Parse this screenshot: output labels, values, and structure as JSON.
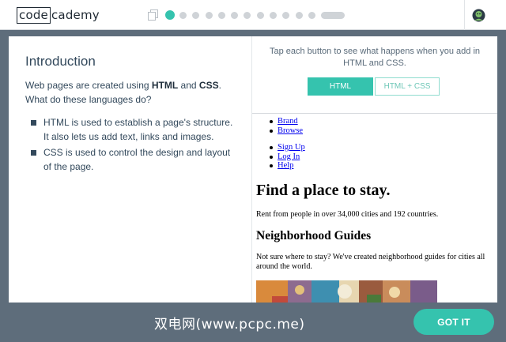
{
  "header": {
    "logo_box": "code",
    "logo_rest": "cademy",
    "progress": {
      "total_dots": 13,
      "current": 1
    },
    "icons": {
      "left": "document-icon",
      "right": "avatar-icon"
    }
  },
  "lesson": {
    "title": "Introduction",
    "intro_prefix": "Web pages are created using ",
    "intro_html": "HTML",
    "intro_and": " and ",
    "intro_css": "CSS",
    "intro_suffix": ". What do these languages do?",
    "bullets": [
      "HTML is used to establish a page's structure. It also lets us add text, links and images.",
      "CSS is used to control the design and layout of the page."
    ]
  },
  "demo": {
    "instruction": "Tap each button to see what happens when you add in HTML and CSS.",
    "btn_html": "HTML",
    "btn_html_css": "HTML + CSS"
  },
  "preview": {
    "nav1": [
      "Brand",
      "Browse"
    ],
    "nav2": [
      "Sign Up",
      "Log In",
      "Help"
    ],
    "h1": "Find a place to stay.",
    "text1": "Rent from people in over 34,000 cities and 192 countries.",
    "h2": "Neighborhood Guides",
    "text2": "Not sure where to stay? We've created neighborhood guides for cities all around the world."
  },
  "footer": {
    "watermark": "双电网(www.pcpc.me)",
    "got_it": "GOT IT"
  },
  "colors": {
    "accent": "#35c3ae",
    "background": "#5e6d7b",
    "text_dark": "#33495c",
    "link": "#0000ee"
  }
}
